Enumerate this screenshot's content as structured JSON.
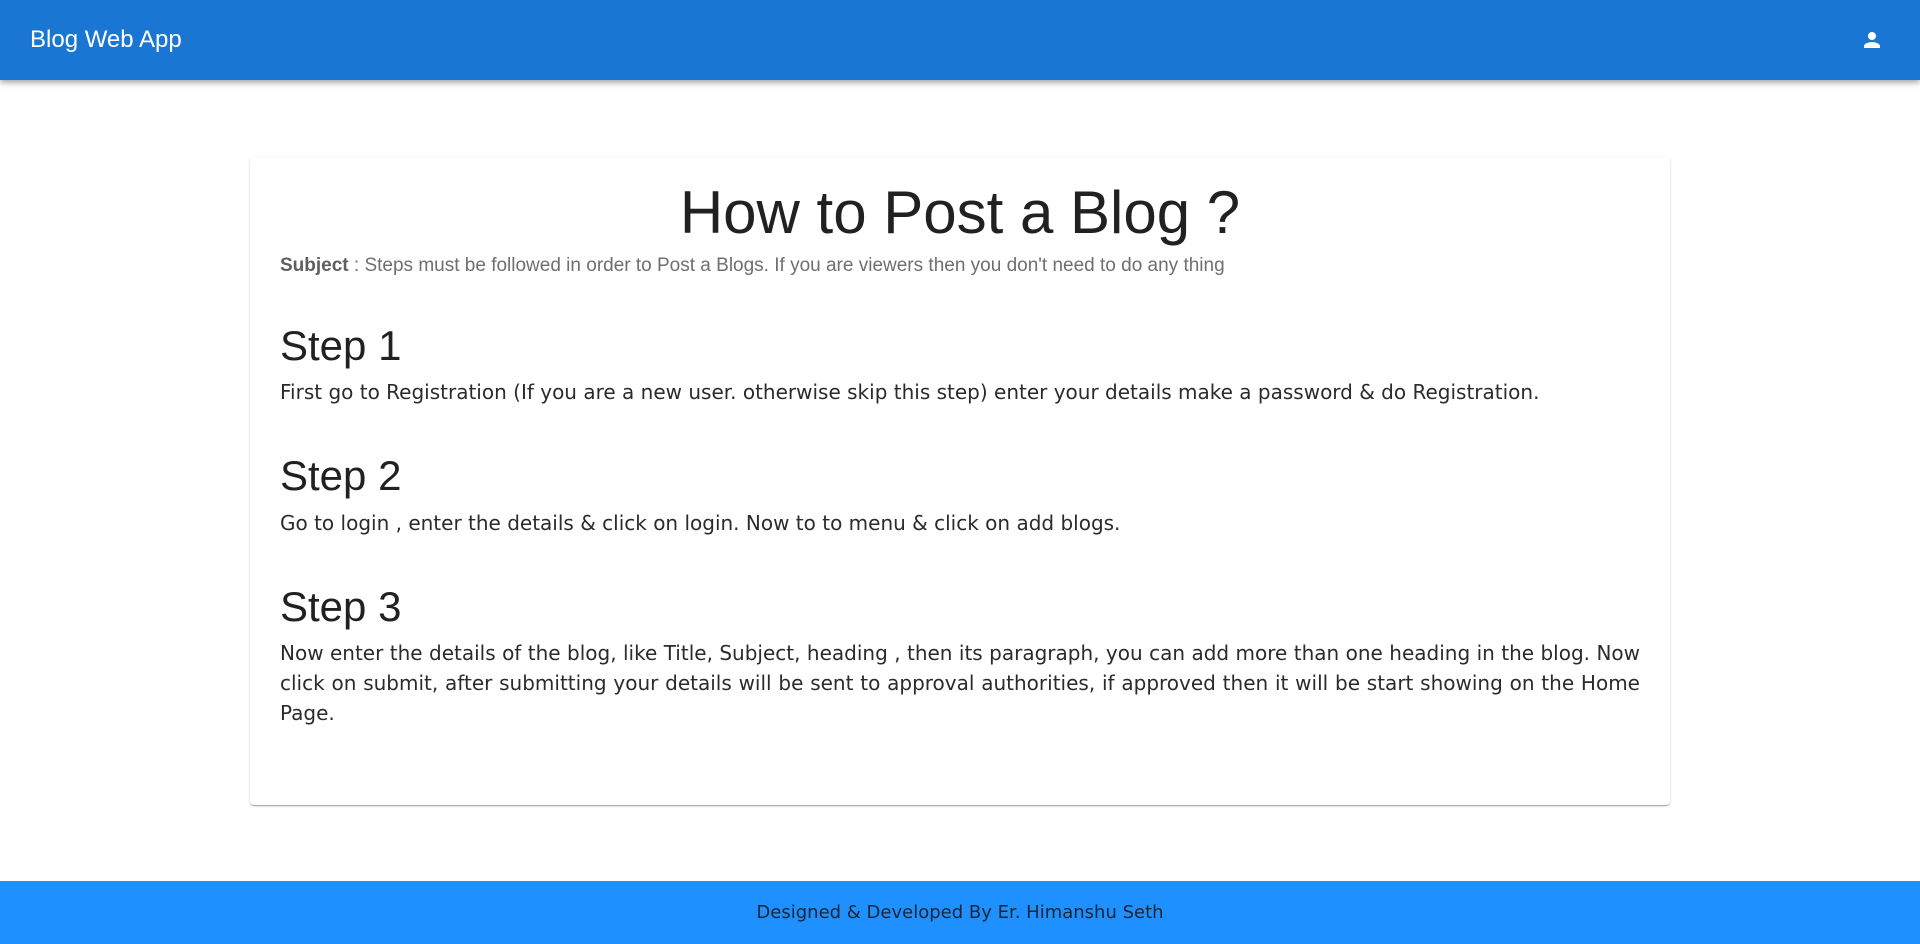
{
  "appbar": {
    "title": "Blog Web App",
    "account_icon": "person-icon",
    "color": "#1976d2"
  },
  "post": {
    "title": "How to Post a Blog ?",
    "subject_label": "Subject",
    "subject_separator": " : ",
    "subject_text": "Steps must be followed in order to Post a Blogs. If you are viewers then you don't need to do any thing",
    "steps": [
      {
        "heading": "Step 1",
        "text": "First go to Registration (If you are a new user. otherwise skip this step) enter your details make a password & do Registration."
      },
      {
        "heading": "Step 2",
        "text": "Go to login , enter the details & click on login. Now to to menu & click on add blogs."
      },
      {
        "heading": "Step 3",
        "text": "Now enter the details of the blog, like Title, Subject, heading , then its paragraph, you can add more than one heading in the blog. Now click on submit, after submitting your details will be sent to approval authorities, if approved then it will be start showing on the Home Page."
      }
    ]
  },
  "footer": {
    "text": "Designed & Developed By Er. Himanshu Seth",
    "color": "#1e90ff"
  }
}
